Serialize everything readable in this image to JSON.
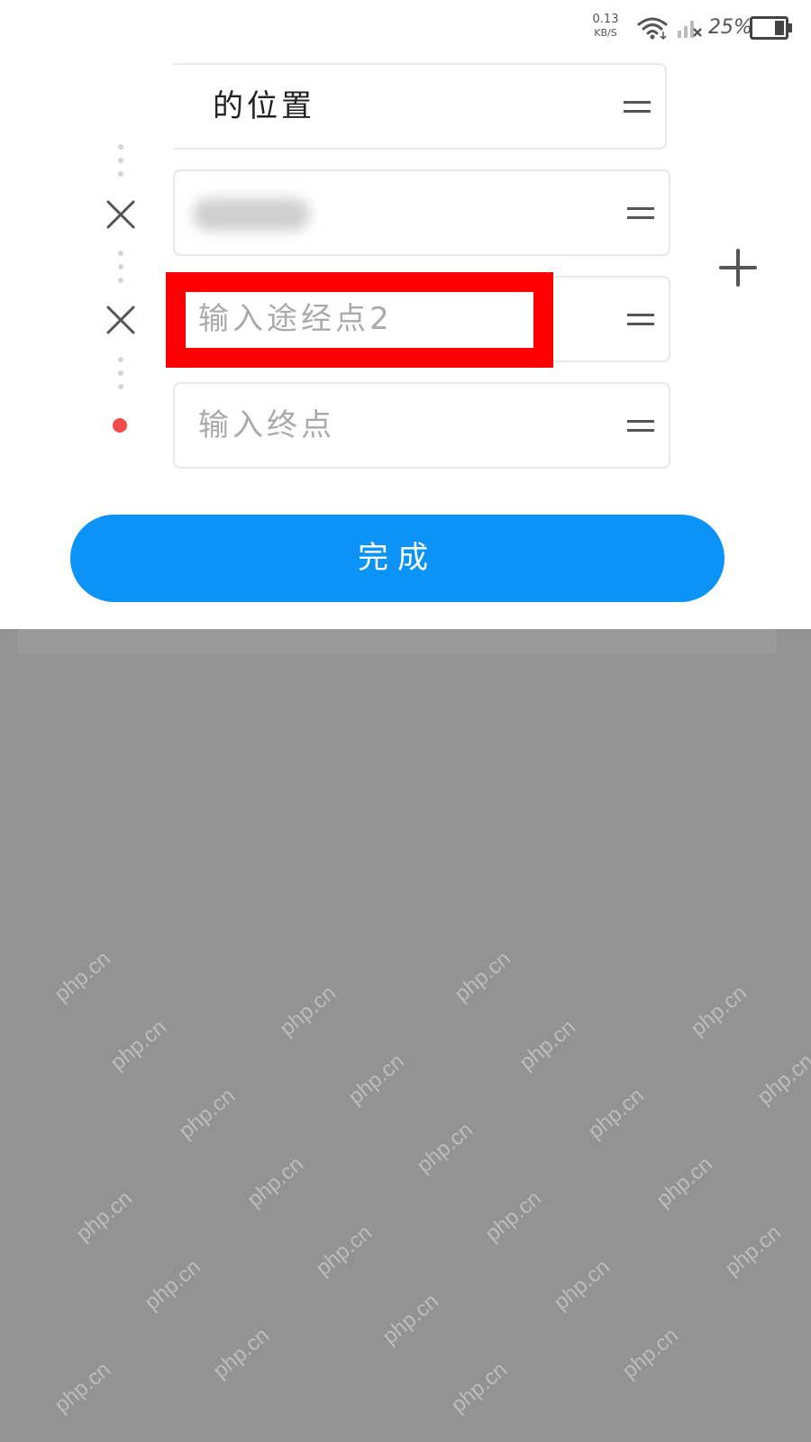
{
  "status_bar": {
    "net_speed_value": "0.13",
    "net_speed_unit": "KB/S",
    "battery_percent": "25%",
    "icons": [
      "wifi-icon",
      "signal-icon",
      "battery-icon"
    ]
  },
  "route": {
    "start": {
      "value": "我的位置",
      "visible_value": "我的位置"
    },
    "waypoint1": {
      "value_blurred": true
    },
    "waypoint2": {
      "placeholder": "输入途经点2"
    },
    "destination": {
      "placeholder": "输入终点"
    }
  },
  "actions": {
    "done_label": "完成"
  },
  "watermark": {
    "text": "php.cn"
  },
  "colors": {
    "accent": "#0b93f8",
    "highlight": "#ff0000",
    "destination_dot": "#f04c4c",
    "overlay": "#939393"
  }
}
